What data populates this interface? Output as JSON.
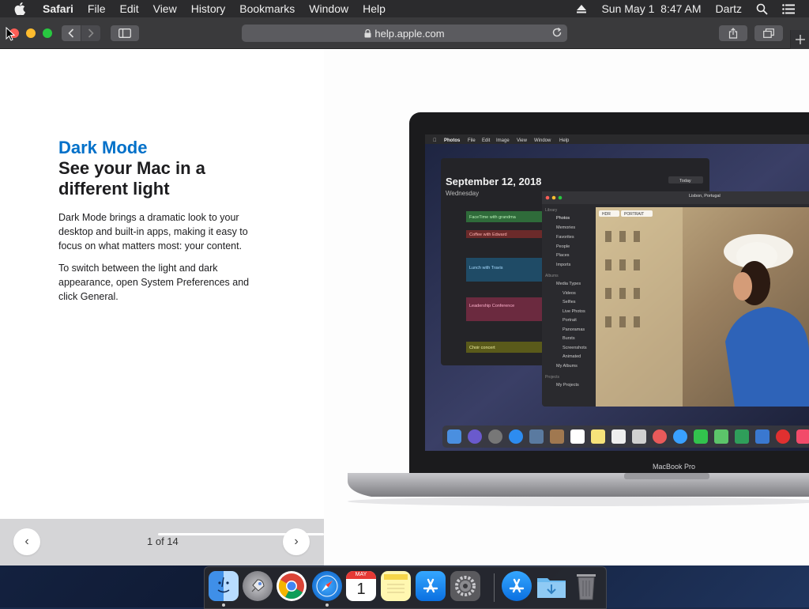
{
  "menubar": {
    "app_name": "Safari",
    "menus": [
      "File",
      "Edit",
      "View",
      "History",
      "Bookmarks",
      "Window",
      "Help"
    ],
    "datetime": "Sun May 1  8:47 AM",
    "user": "Dartz"
  },
  "browser": {
    "url": "help.apple.com"
  },
  "article": {
    "eyebrow": "Dark Mode",
    "headline": "See your Mac in a different light",
    "paragraph1": "Dark Mode brings a dramatic look to your desktop and built-in apps, making it easy to focus on what matters most: your content.",
    "paragraph2": "To switch between the light and dark appearance, open System Preferences and click General."
  },
  "gallery": {
    "counter": "1 of 14",
    "prev_label": "‹",
    "next_label": "›",
    "progress_fraction": 0.07
  },
  "screenshot_content": {
    "laptop_label": "MacBook Pro",
    "photos_menu": [
      "Photos",
      "File",
      "Edit",
      "Image",
      "View",
      "Window",
      "Help"
    ],
    "calendar_date": "September 12, 2018",
    "calendar_weekday": "Wednesday",
    "calendar_today": "Today",
    "calendar_events": [
      "FaceTime with grandma",
      "Coffee with Edward",
      "Lunch with Travis",
      "Leadership Conference",
      "Choir concert"
    ],
    "photo_location": "Lisbon, Portugal",
    "photos_sidebar": [
      "Library",
      "Photos",
      "Memories",
      "Favorites",
      "People",
      "Places",
      "Imports",
      "Albums",
      "Media Types",
      "Videos",
      "Selfies",
      "Live Photos",
      "Portrait",
      "Panoramas",
      "Bursts",
      "Screenshots",
      "Animated",
      "My Albums",
      "Projects",
      "My Projects"
    ],
    "photo_badges": [
      "HDR",
      "PORTRAIT"
    ]
  },
  "dock": {
    "apps": [
      "Finder",
      "Launchpad",
      "Chrome",
      "Safari",
      "Calendar",
      "Notes",
      "App Store",
      "System Preferences",
      "App Store",
      "Downloads",
      "Trash"
    ],
    "calendar_month": "MAY",
    "calendar_day": "1"
  },
  "colors": {
    "accent_blue": "#0070c9",
    "menubar_bg": "#2b2b2d",
    "toolbar_bg": "#3a3a3c",
    "gallery_bar_bg": "#d5d5d7"
  }
}
